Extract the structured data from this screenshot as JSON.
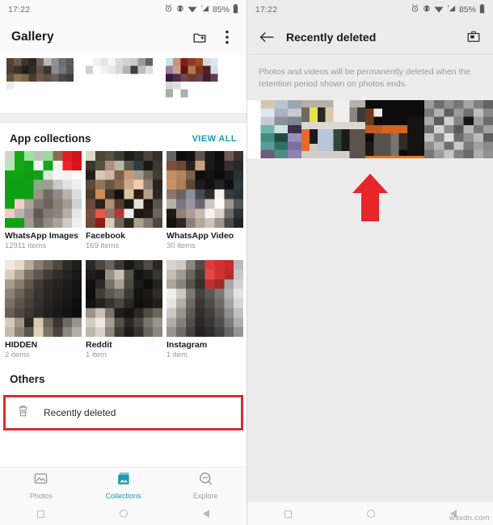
{
  "colors": {
    "teal": "#1a9bae",
    "highlight_red": "#d52b33",
    "arrow_red": "#e8252b",
    "thumb_underline_orange": "#e8761c",
    "panel_bg": "#ececec",
    "card_bg": "#ffffff"
  },
  "status_bar": {
    "time": "17:22",
    "battery_text": "85%",
    "icons": [
      "alarm-icon",
      "vibrate-icon",
      "wifi-icon",
      "signal-icon",
      "battery-icon"
    ]
  },
  "left_screen": {
    "app_bar": {
      "title": "Gallery",
      "actions": [
        {
          "name": "add-folder-icon",
          "label": "Add folder"
        },
        {
          "name": "overflow-menu-icon",
          "label": "More options"
        }
      ]
    },
    "app_collections": {
      "title": "App collections",
      "view_all_label": "VIEW ALL",
      "items": [
        {
          "name": "WhatsApp Images",
          "count": "12911 items"
        },
        {
          "name": "Facebook",
          "count": "169 items"
        },
        {
          "name": "WhatsApp Video",
          "count": "30 items"
        },
        {
          "name": "HIDDEN",
          "count": "2 items"
        },
        {
          "name": "Reddit",
          "count": "1 item"
        },
        {
          "name": "Instagram",
          "count": "1 item"
        }
      ]
    },
    "others": {
      "title": "Others",
      "recently_deleted_label": "Recently deleted"
    },
    "bottom_nav": {
      "items": [
        {
          "label": "Photos",
          "icon": "photos-icon",
          "active": false
        },
        {
          "label": "Collections",
          "icon": "collections-icon",
          "active": true
        },
        {
          "label": "Explore",
          "icon": "explore-icon",
          "active": false
        }
      ]
    }
  },
  "right_screen": {
    "app_bar": {
      "back_icon": "back-arrow-icon",
      "title": "Recently deleted",
      "action_icon": "empty-trash-icon"
    },
    "notice": "Photos and videos will be permanently deleted when the retention period shown on photos ends.",
    "deleted_items_count": 4
  },
  "android_nav": {
    "buttons": [
      "recents-button",
      "home-button",
      "back-button"
    ]
  },
  "watermark": "wsxdn.com"
}
